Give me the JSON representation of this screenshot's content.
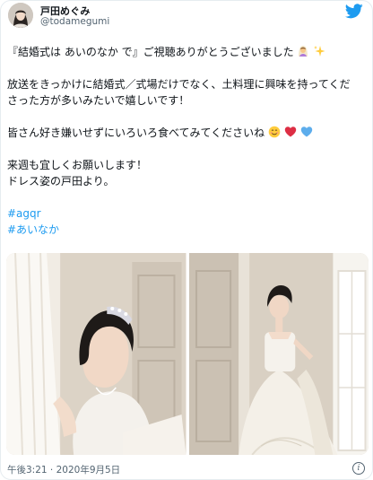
{
  "user": {
    "display_name": "戸田めぐみ",
    "handle": "@todamegumi",
    "avatar_icon": "avatar-photo",
    "platform_icon": "twitter-bird-icon"
  },
  "tweet": {
    "line1": "『結婚式は あいのなか で』ご視聴ありがとうございました",
    "line1_emoji": [
      "woman-with-veil",
      "sparkles"
    ],
    "line2": "放送をきっかけに結婚式／式場だけでなく、土料理に興味を持ってくだ",
    "line3": "さった方が多いみたいで嬉しいです！",
    "line4": "皆さん好き嫌いせずにいろいろ食べてみてくださいね",
    "line4_emoji": [
      "smiling-face",
      "red-heart",
      "blue-heart"
    ],
    "line5": "来週も宜しくお願いします！",
    "line6": "ドレス姿の戸田より。",
    "hashtags": [
      "#agqr",
      "#あいなか"
    ]
  },
  "media": {
    "photos": [
      "bride-photo-left",
      "bride-photo-right"
    ]
  },
  "meta": {
    "timestamp": "午後3:21 · 2020年9月5日",
    "info_icon": "info-icon"
  },
  "colors": {
    "link": "#1d9bf0",
    "text": "#0f1419",
    "secondary": "#536471",
    "twitter_blue": "#1d9bf0"
  }
}
